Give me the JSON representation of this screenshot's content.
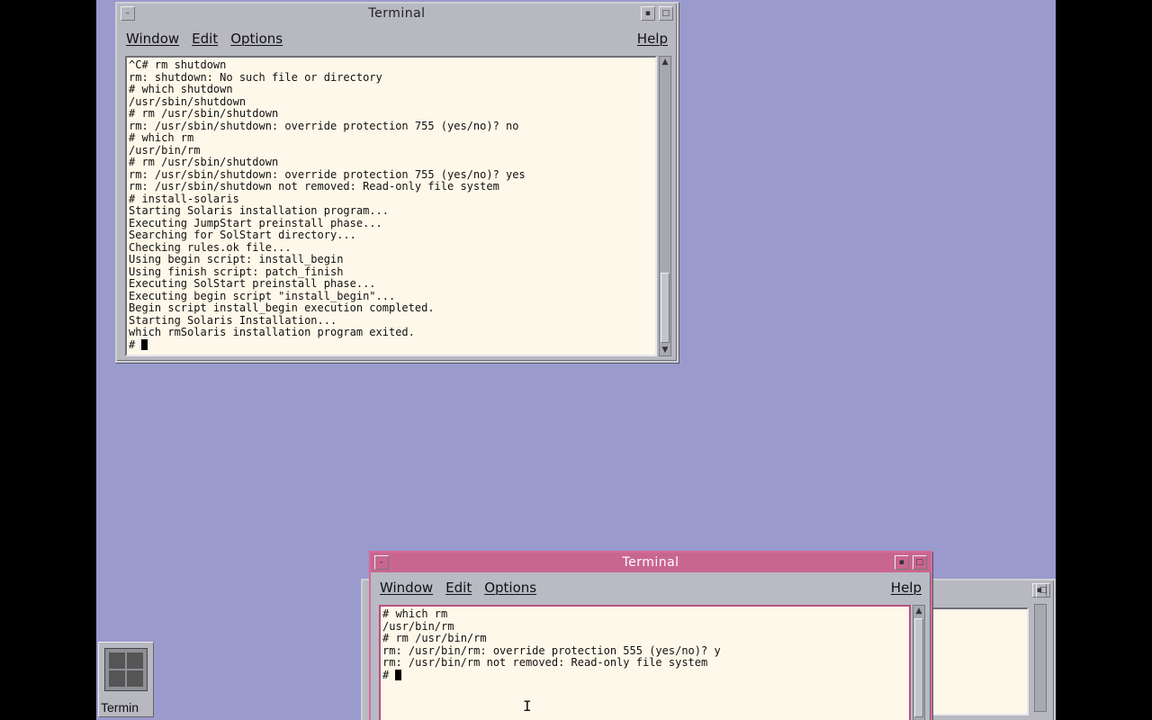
{
  "windows": {
    "top": {
      "title": "Terminal",
      "menu": [
        "Window",
        "Edit",
        "Options"
      ],
      "help": "Help",
      "lines": [
        "^C# rm shutdown",
        "rm: shutdown: No such file or directory",
        "# which shutdown",
        "/usr/sbin/shutdown",
        "# rm /usr/sbin/shutdown",
        "rm: /usr/sbin/shutdown: override protection 755 (yes/no)? no",
        "# which rm",
        "/usr/bin/rm",
        "# rm /usr/sbin/shutdown",
        "rm: /usr/sbin/shutdown: override protection 755 (yes/no)? yes",
        "rm: /usr/sbin/shutdown not removed: Read-only file system",
        "# install-solaris",
        "Starting Solaris installation program...",
        "Executing JumpStart preinstall phase...",
        "Searching for SolStart directory...",
        "Checking rules.ok file...",
        "Using begin script: install_begin",
        "Using finish script: patch_finish",
        "Executing SolStart preinstall phase...",
        "Executing begin script \"install_begin\"...",
        "Begin script install_begin execution completed.",
        "Starting Solaris Installation...",
        "which rmSolaris installation program exited."
      ],
      "prompt": "# "
    },
    "bottom": {
      "title": "Terminal",
      "menu": [
        "Window",
        "Edit",
        "Options"
      ],
      "help": "Help",
      "lines": [
        "# which rm",
        "/usr/bin/rm",
        "# rm /usr/bin/rm",
        "rm: /usr/bin/rm: override protection 555 (yes/no)? y",
        "rm: /usr/bin/rm not removed: Read-only file system"
      ],
      "prompt": "# "
    }
  },
  "icon": {
    "label": "Termin",
    "name": "terminal-icon"
  },
  "colors": {
    "desktop": "#9a9acc",
    "terminal_bg": "#fdf8e9",
    "active_title": "#c96690"
  }
}
